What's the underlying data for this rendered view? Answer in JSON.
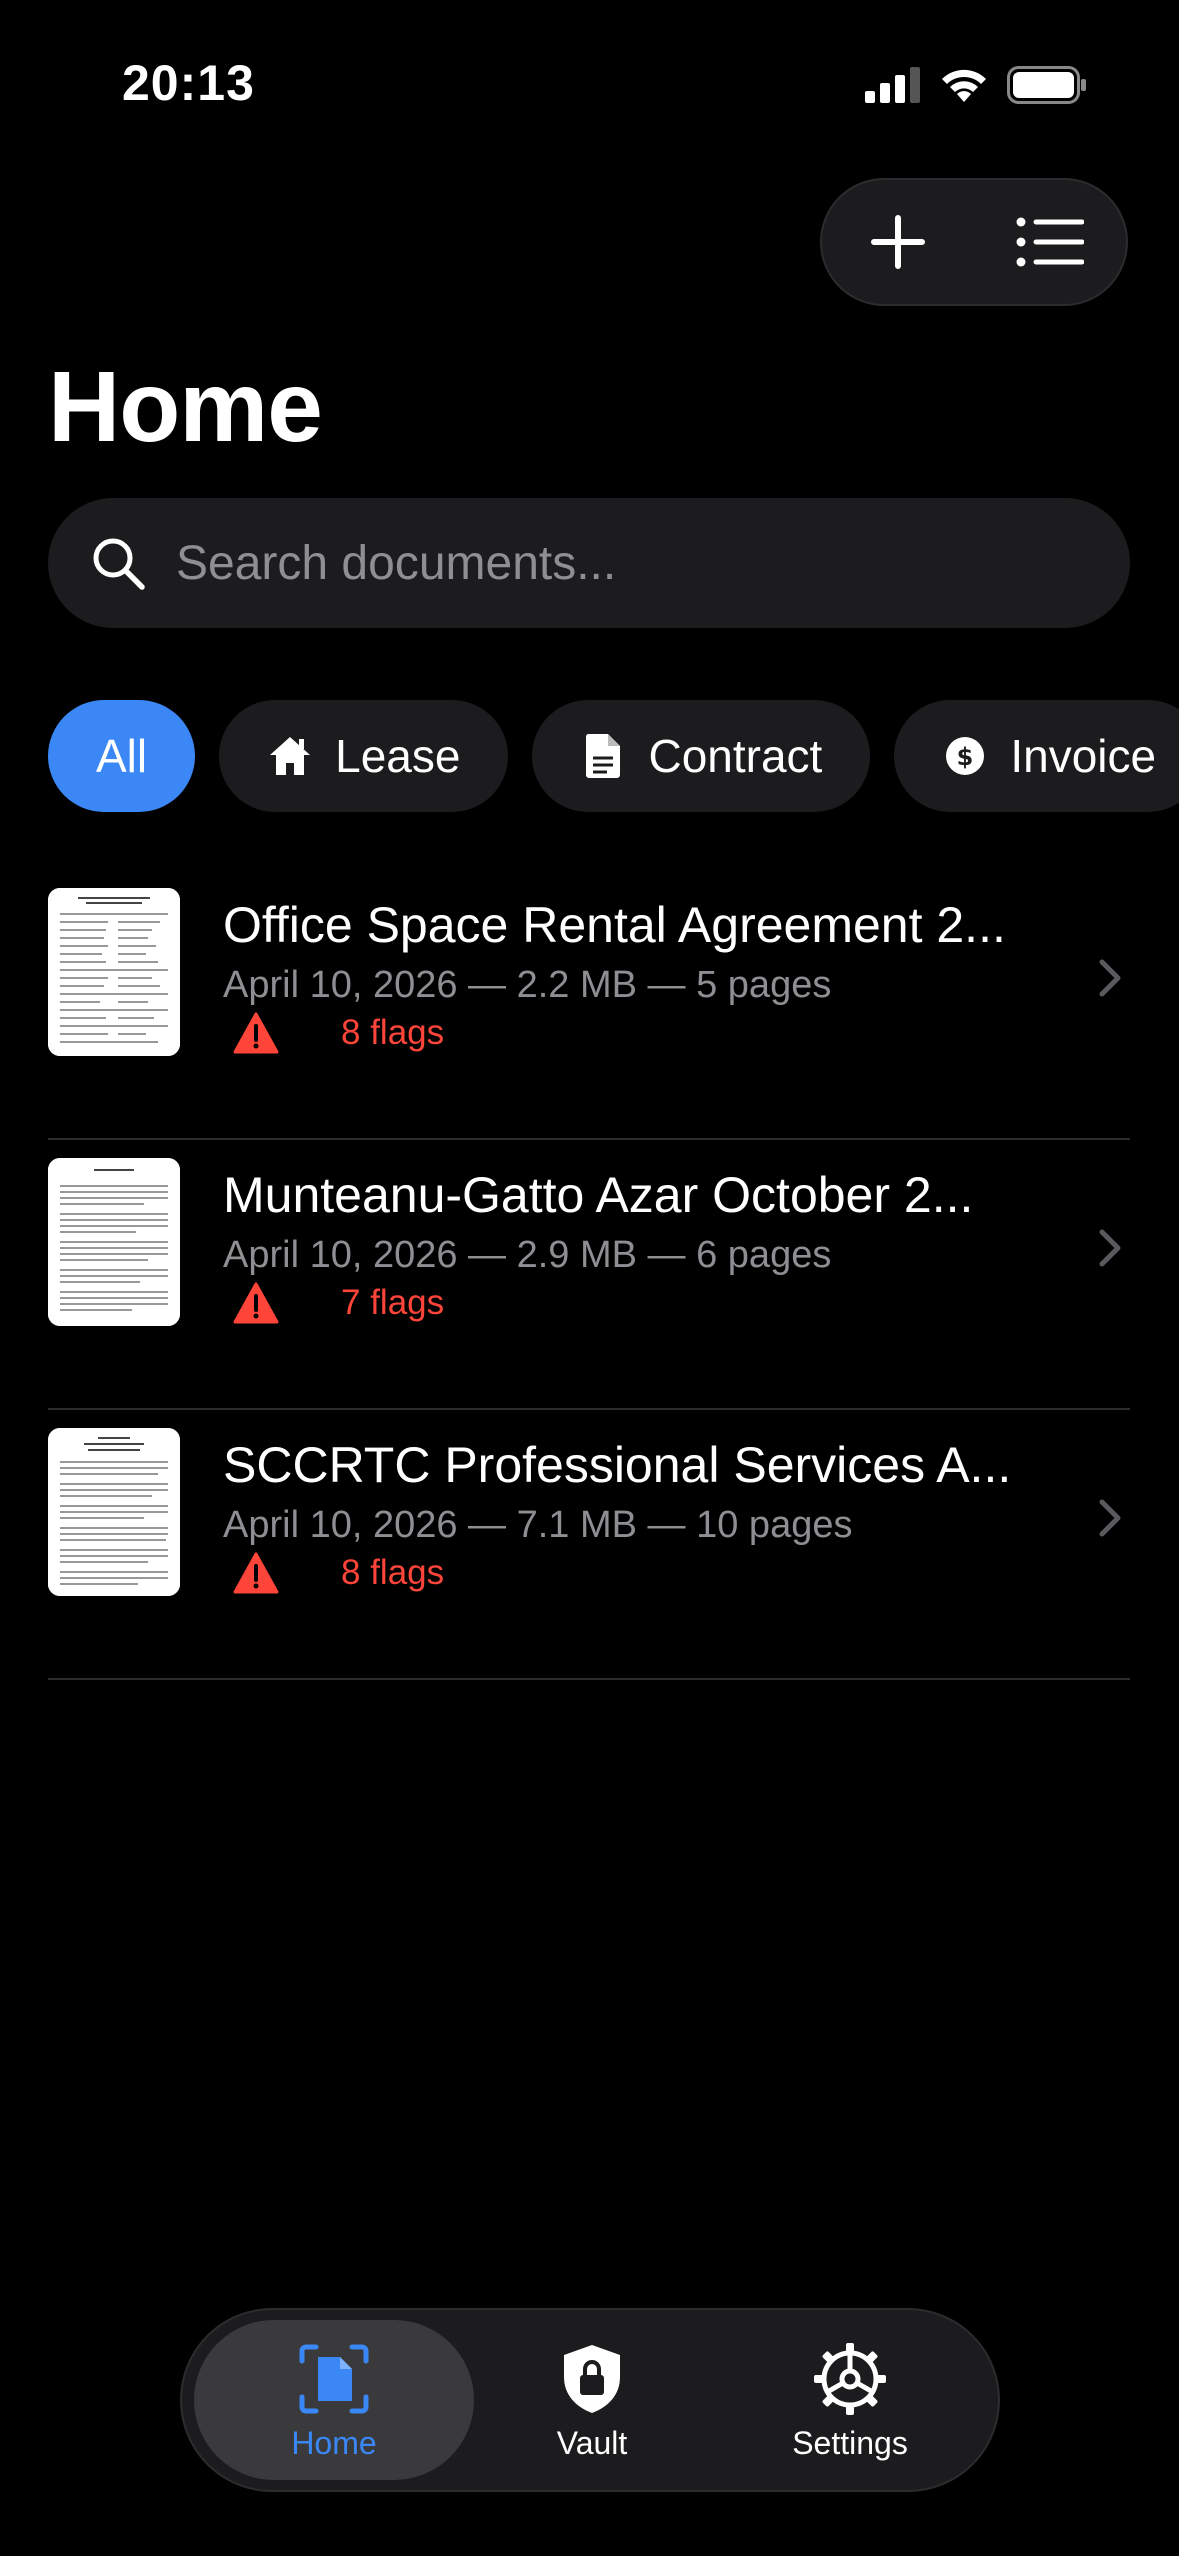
{
  "status_bar": {
    "time": "20:13"
  },
  "header": {
    "title": "Home",
    "add_icon": "plus-icon",
    "list_icon": "list-icon"
  },
  "search": {
    "placeholder": "Search documents...",
    "value": ""
  },
  "filters": [
    {
      "label": "All",
      "icon": "",
      "active": true
    },
    {
      "label": "Lease",
      "icon": "house-icon",
      "active": false
    },
    {
      "label": "Contract",
      "icon": "document-icon",
      "active": false
    },
    {
      "label": "Invoice",
      "icon": "dollar-icon",
      "active": false
    }
  ],
  "documents": [
    {
      "title": "Office Space Rental Agreement 2...",
      "meta": "April 10, 2026 — 2.2 MB — 5 pages",
      "flags": "8 flags"
    },
    {
      "title": "Munteanu-Gatto Azar October 2...",
      "meta": "April 10, 2026 — 2.9 MB — 6 pages",
      "flags": "7 flags"
    },
    {
      "title": "SCCRTC Professional Services A...",
      "meta": "April 10, 2026 — 7.1 MB — 10 pages",
      "flags": "8 flags"
    }
  ],
  "tab_bar": [
    {
      "label": "Home",
      "icon": "document-scan-icon",
      "active": true
    },
    {
      "label": "Vault",
      "icon": "lock-shield-icon",
      "active": false
    },
    {
      "label": "Settings",
      "icon": "gear-icon",
      "active": false
    }
  ],
  "colors": {
    "accent": "#3a87f5",
    "flag": "#ff453a",
    "surface": "#1c1c1e",
    "background": "#000000"
  }
}
